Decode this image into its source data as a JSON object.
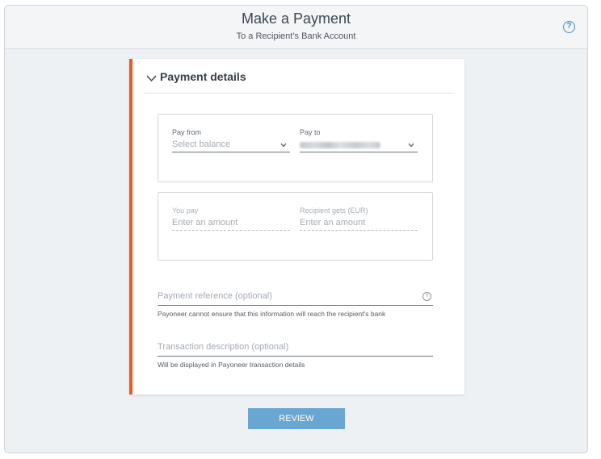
{
  "header": {
    "title": "Make a Payment",
    "subtitle": "To a Recipient’s Bank Account",
    "help_icon": "question-circle-icon"
  },
  "section": {
    "title": "Payment details",
    "toggle_icon": "chevron-down-icon"
  },
  "pay_from": {
    "label": "Pay from",
    "placeholder": "Select balance"
  },
  "pay_to": {
    "label": "Pay to",
    "value_blurred": true
  },
  "you_pay": {
    "label": "You pay",
    "placeholder": "Enter an amount"
  },
  "recipient_gets": {
    "label": "Recipient gets (EUR)",
    "placeholder": "Enter an amount"
  },
  "payment_reference": {
    "placeholder": "Payment reference (optional)",
    "hint": "Payoneer cannot ensure that this information will reach the recipient's bank"
  },
  "transaction_description": {
    "placeholder": "Transaction description (optional)",
    "hint": "Will be displayed in Payoneer transaction details"
  },
  "review_button": {
    "label": "REVIEW"
  },
  "colors": {
    "accent": "#f05a1e",
    "button": "#6aa6d2",
    "help": "#3f8fd0"
  }
}
